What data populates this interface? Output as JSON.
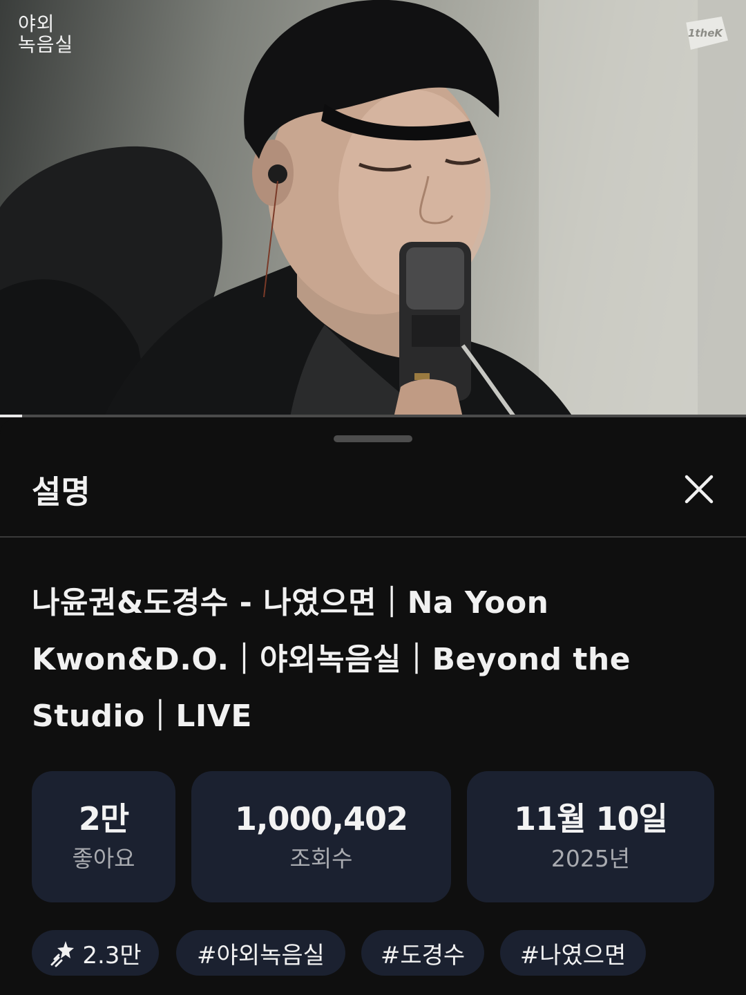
{
  "video": {
    "channel_logo_text": "야외\n녹음실",
    "watermark_text": "1theK",
    "progress_fraction": 0.03
  },
  "sheet": {
    "title": "설명",
    "close_icon": "close-icon"
  },
  "description": {
    "video_title": "나윤권&도경수 - 나였으면｜Na Yoon Kwon&D.O.｜야외녹음실｜Beyond the Studio｜LIVE"
  },
  "stats": {
    "likes": {
      "value": "2만",
      "label": "좋아요"
    },
    "views": {
      "value": "1,000,402",
      "label": "조회수"
    },
    "date": {
      "value": "11월 10일",
      "label": "2025년"
    }
  },
  "chips": {
    "remix": {
      "icon": "remix-sparkle-icon",
      "label": "2.3만"
    },
    "tags": [
      "#야외녹음실",
      "#도경수",
      "#나였으면"
    ]
  },
  "colors": {
    "background": "#0f0f0f",
    "card": "#1b2130",
    "text_primary": "#f1f1f1",
    "text_secondary": "#a9abb0"
  }
}
